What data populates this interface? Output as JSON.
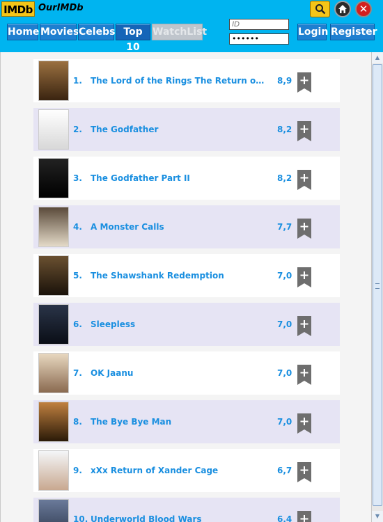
{
  "app": {
    "logo_text": "IMDb",
    "title": "OurIMDb"
  },
  "nav": [
    {
      "label": "Home"
    },
    {
      "label": "Movies"
    },
    {
      "label": "Celebs"
    },
    {
      "label": "Top 10"
    },
    {
      "label": "WatchList"
    }
  ],
  "auth": {
    "id_placeholder": "ID",
    "password_value": "••••••",
    "login_label": "Login",
    "register_label": "Register"
  },
  "header_icons": {
    "search": "search-icon",
    "home": "home-icon",
    "close": "close-icon",
    "close_glyph": "✕"
  },
  "colors": {
    "header_bg": "#00b4f0",
    "accent_text": "#1a8fe0",
    "row_alt_bg": "#e6e4f4",
    "logo_bg": "#f5c518"
  },
  "movies": [
    {
      "rank": "1.",
      "title": "The Lord of the Rings The Return of th...",
      "rating": "8,9",
      "poster_color": "#6b4a2a"
    },
    {
      "rank": "2.",
      "title": "The Godfather",
      "rating": "8,2",
      "poster_color": "#f0f0f0"
    },
    {
      "rank": "3.",
      "title": "The Godfather Part II",
      "rating": "8,2",
      "poster_color": "#111111"
    },
    {
      "rank": "4.",
      "title": "A Monster Calls",
      "rating": "7,7",
      "poster_color": "#c8b89a"
    },
    {
      "rank": "5.",
      "title": "The Shawshank Redemption",
      "rating": "7,0",
      "poster_color": "#3a2a1a"
    },
    {
      "rank": "6.",
      "title": "Sleepless",
      "rating": "7,0",
      "poster_color": "#1a2230"
    },
    {
      "rank": "7.",
      "title": "OK Jaanu",
      "rating": "7,0",
      "poster_color": "#d8c8b0"
    },
    {
      "rank": "8.",
      "title": "The Bye Bye Man",
      "rating": "7,0",
      "poster_color": "#7a5020"
    },
    {
      "rank": "9.",
      "title": "xXx Return of Xander Cage",
      "rating": "6,7",
      "poster_color": "#e8eef4"
    },
    {
      "rank": "10.",
      "title": "Underworld Blood Wars",
      "rating": "6,4",
      "poster_color": "#4a5a7a"
    }
  ],
  "add_button_icon": "add-bookmark-icon",
  "add_glyph": "+"
}
